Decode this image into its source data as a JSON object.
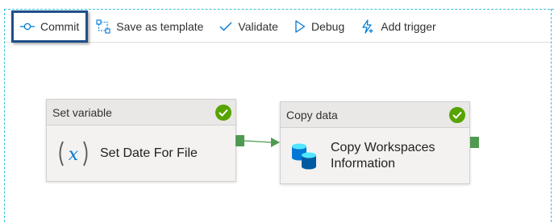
{
  "toolbar": {
    "commit_label": "Commit",
    "save_template_label": "Save as template",
    "validate_label": "Validate",
    "debug_label": "Debug",
    "add_trigger_label": "Add trigger"
  },
  "activities": [
    {
      "type_label": "Set variable",
      "name": "Set Date For File",
      "status": "succeeded",
      "icon": "variable-icon"
    },
    {
      "type_label": "Copy data",
      "name_line1": "Copy Workspaces",
      "name_line2": "Information",
      "status": "succeeded",
      "icon": "database-icon"
    }
  ],
  "colors": {
    "accent": "#0078d4",
    "success": "#57a300",
    "port": "#4f9a52",
    "commit_border": "#1f4e8a"
  }
}
